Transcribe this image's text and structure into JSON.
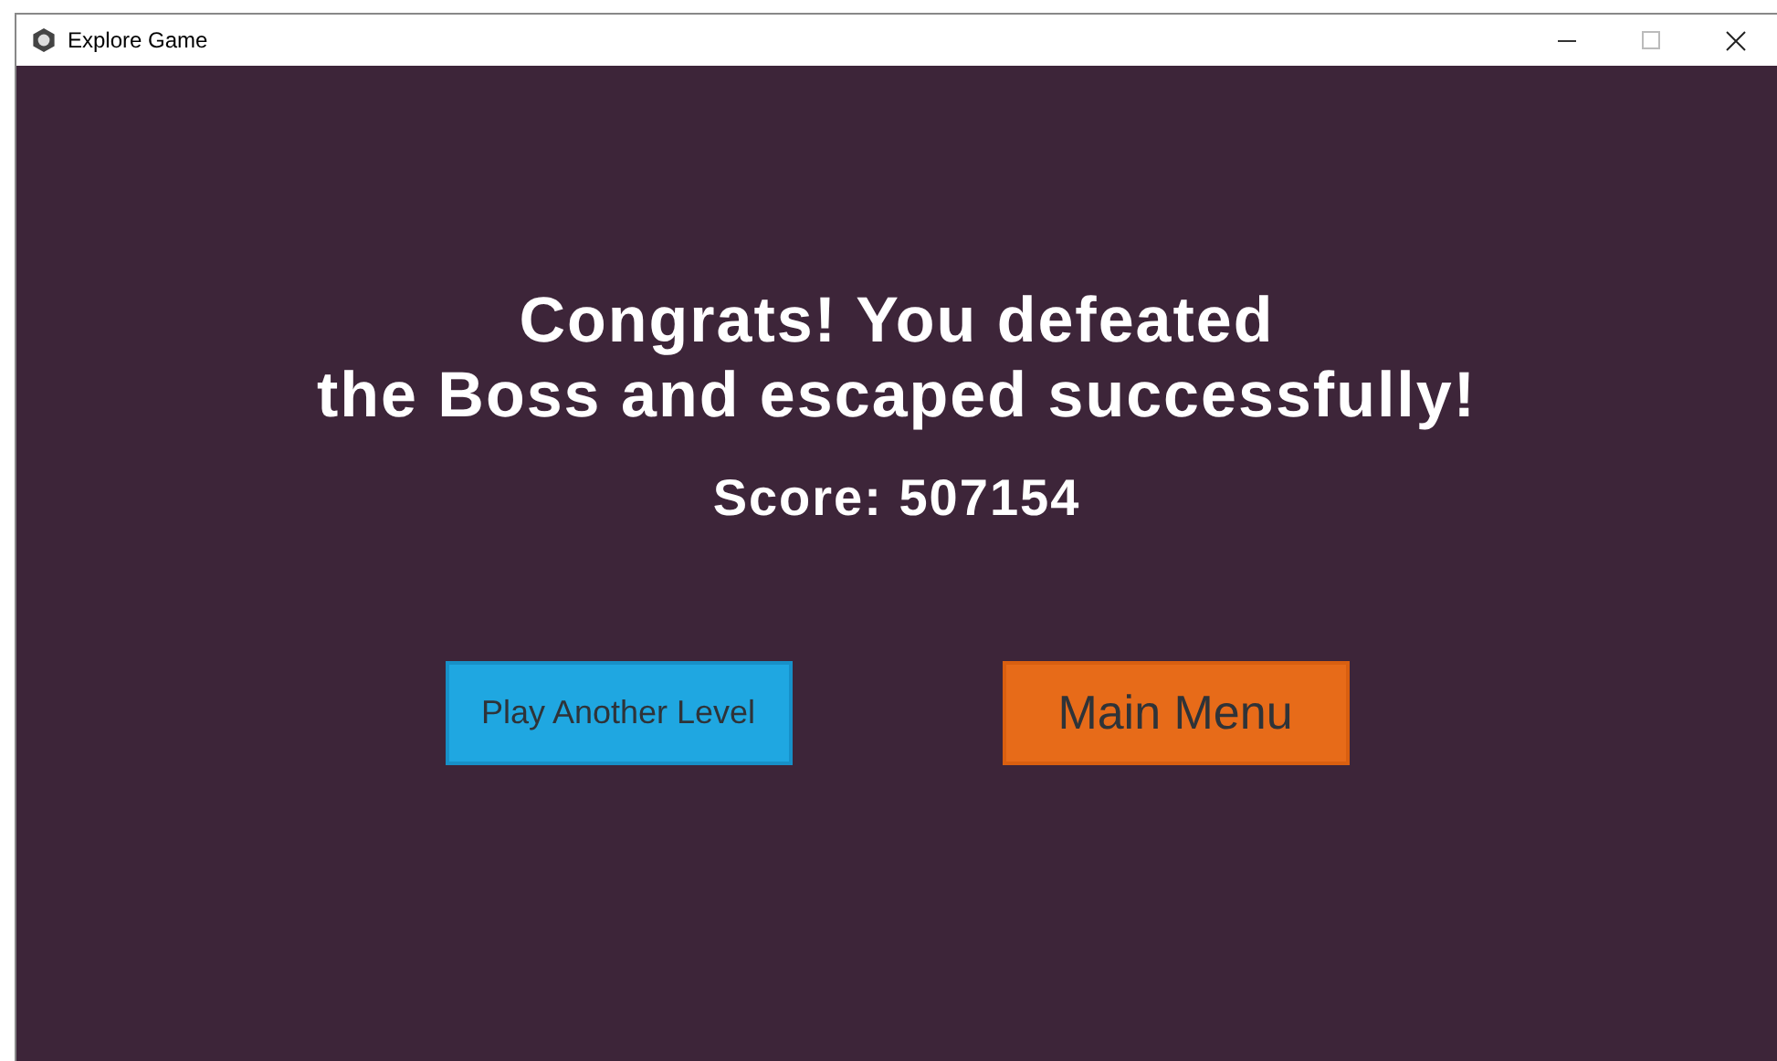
{
  "window": {
    "title": "Explore Game"
  },
  "message": {
    "lines": [
      "Congrats! You defeated",
      "the Boss and escaped successfully!"
    ],
    "score": "Score: 507154"
  },
  "buttons": [
    {
      "label": "Play Another Level",
      "kind": "secondary"
    },
    {
      "label": "Main Menu",
      "kind": "primary"
    }
  ]
}
